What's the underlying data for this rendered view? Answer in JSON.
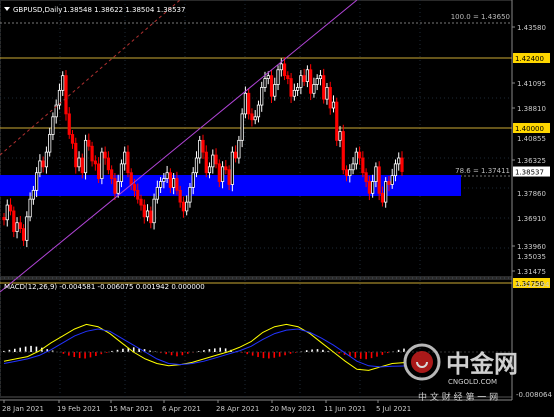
{
  "header": {
    "symbol_label": "GBPUSD,Daily",
    "ohlc": "1.38548 1.38622 1.38504 1.38537"
  },
  "colors": {
    "background": "#000000",
    "bull_candle": "#ffffff",
    "bear_candle": "#ff0000",
    "grid": "#2a3a4a",
    "level_line": "#ccaa33",
    "zone": "#0000ff",
    "trendline": "#b044d6",
    "dashed_line": "#b03030",
    "macd_line": "#ffff00",
    "signal_line": "#2233ff",
    "histogram": "#ffffff",
    "price_tag_bg": "#ffd700",
    "current_tag_bg": "#ffffff"
  },
  "fib_labels": {
    "level_100": "100.0 = 1.43650",
    "level_786": "78.6 = 1.37411"
  },
  "price_axis": {
    "ticks": [
      "1.43580",
      "1.41095",
      "1.38810",
      "1.36325",
      "1.33960",
      "1.31475"
    ],
    "level_tags": [
      "1.42400",
      "1.40000",
      "1.34750"
    ],
    "current_price": "1.38537",
    "hidden_ticks": [
      "1.40855",
      "1.37860",
      "1.36910",
      "1.35035"
    ]
  },
  "macd": {
    "label": "MACD(12,26,9) -0.004581 -0.006075 0.001942 0.000000",
    "top_value": "0.012994",
    "bottom_value": "-0.008064"
  },
  "time_axis": {
    "labels": [
      "28 Jan 2021",
      "19 Feb 2021",
      "15 Mar 2021",
      "6 Apr 2021",
      "28 Apr 2021",
      "20 May 2021",
      "11 Jun 2021",
      "5 Jul 2021"
    ]
  },
  "watermark": {
    "brand": "中金网",
    "site": "CNGOLD.COM",
    "slogan": "中 文 财 经 第 一 网"
  },
  "chart_data": {
    "type": "candlestick",
    "instrument": "GBPUSD",
    "timeframe": "Daily",
    "ylim": [
      1.312,
      1.439
    ],
    "x_labels": [
      "28 Jan 2021",
      "19 Feb 2021",
      "15 Mar 2021",
      "6 Apr 2021",
      "28 Apr 2021",
      "20 May 2021",
      "11 Jun 2021",
      "5 Jul 2021"
    ],
    "levels": [
      1.424,
      1.4,
      1.3475
    ],
    "fib_levels": [
      {
        "ratio": "100.0",
        "value": 1.4365
      },
      {
        "ratio": "78.6",
        "value": 1.37411
      }
    ],
    "zone": [
      1.366,
      1.3741
    ],
    "closes": [
      1.369,
      1.374,
      1.372,
      1.365,
      1.368,
      1.366,
      1.362,
      1.37,
      1.376,
      1.379,
      1.385,
      1.389,
      1.387,
      1.392,
      1.398,
      1.404,
      1.408,
      1.413,
      1.418,
      1.405,
      1.398,
      1.395,
      1.387,
      1.39,
      1.385,
      1.396,
      1.394,
      1.389,
      1.388,
      1.383,
      1.392,
      1.39,
      1.386,
      1.383,
      1.378,
      1.382,
      1.388,
      1.392,
      1.385,
      1.381,
      1.379,
      1.376,
      1.374,
      1.37,
      1.372,
      1.368,
      1.376,
      1.38,
      1.382,
      1.383,
      1.385,
      1.38,
      1.383,
      1.379,
      1.375,
      1.372,
      1.375,
      1.38,
      1.385,
      1.39,
      1.396,
      1.392,
      1.385,
      1.387,
      1.391,
      1.388,
      1.382,
      1.387,
      1.386,
      1.381,
      1.392,
      1.39,
      1.396,
      1.405,
      1.412,
      1.405,
      1.403,
      1.404,
      1.408,
      1.414,
      1.417,
      1.418,
      1.411,
      1.415,
      1.42,
      1.422,
      1.418,
      1.417,
      1.411,
      1.413,
      1.414,
      1.418,
      1.416,
      1.42,
      1.412,
      1.415,
      1.417,
      1.418,
      1.41,
      1.414,
      1.407,
      1.409,
      1.396,
      1.399,
      1.386,
      1.384,
      1.386,
      1.388,
      1.392,
      1.39,
      1.385,
      1.382,
      1.378,
      1.382,
      1.387,
      1.378,
      1.375,
      1.382,
      1.381,
      1.384,
      1.388,
      1.39,
      1.3854
    ],
    "macd": {
      "series": [
        {
          "name": "MACD",
          "values": [
            -0.004,
            -0.003,
            -0.002,
            0.0005,
            0.004,
            0.007,
            0.01,
            0.012,
            0.011,
            0.008,
            0.004,
            0.0,
            -0.003,
            -0.005,
            -0.006,
            -0.0055,
            -0.0045,
            -0.003,
            -0.0015,
            0.0,
            0.002,
            0.0045,
            0.0085,
            0.011,
            0.012,
            0.011,
            0.008,
            0.004,
            0.0,
            -0.004,
            -0.0075,
            -0.008,
            -0.0065,
            -0.005,
            -0.0046
          ]
        },
        {
          "name": "Signal",
          "values": [
            -0.005,
            -0.004,
            -0.003,
            -0.0015,
            0.001,
            0.004,
            0.007,
            0.009,
            0.01,
            0.009,
            0.006,
            0.003,
            0.0,
            -0.003,
            -0.005,
            -0.0055,
            -0.005,
            -0.004,
            -0.0025,
            -0.001,
            0.0005,
            0.0025,
            0.0055,
            0.008,
            0.0095,
            0.01,
            0.0085,
            0.006,
            0.003,
            -0.0005,
            -0.004,
            -0.006,
            -0.0065,
            -0.0062,
            -0.0061
          ]
        }
      ],
      "histogram": [
        0.0006,
        0.0012,
        0.0018,
        0.0024,
        0.003,
        0.0034,
        0.003,
        0.0024,
        0.0016,
        0.0008,
        0.0,
        -0.001,
        -0.002,
        -0.0028,
        -0.0034,
        -0.0036,
        -0.003,
        -0.0022,
        -0.0012,
        -0.0004,
        0.0006,
        0.0012,
        0.0018,
        0.0024,
        0.0026,
        0.0022,
        0.0016,
        0.0008,
        0.0002,
        -0.0006,
        -0.0012,
        -0.0018,
        -0.0024,
        -0.0018,
        -0.001,
        -0.0004,
        0.0004,
        0.001,
        0.0016,
        0.002,
        0.0024,
        0.002,
        0.0012,
        0.0004,
        -0.0004,
        -0.0012,
        -0.002,
        -0.0028,
        -0.0034,
        -0.0036,
        -0.0032,
        -0.0026,
        -0.0018,
        -0.001,
        -0.0004,
        0.0004,
        0.001,
        0.0014,
        0.0016,
        0.0012,
        0.0006,
        0.0,
        -0.0008,
        -0.0016,
        -0.0024,
        -0.0032,
        -0.0038,
        -0.004,
        -0.0034,
        -0.0026,
        -0.0016,
        -0.0006,
        0.0004,
        0.0012,
        0.0019
      ]
    }
  }
}
